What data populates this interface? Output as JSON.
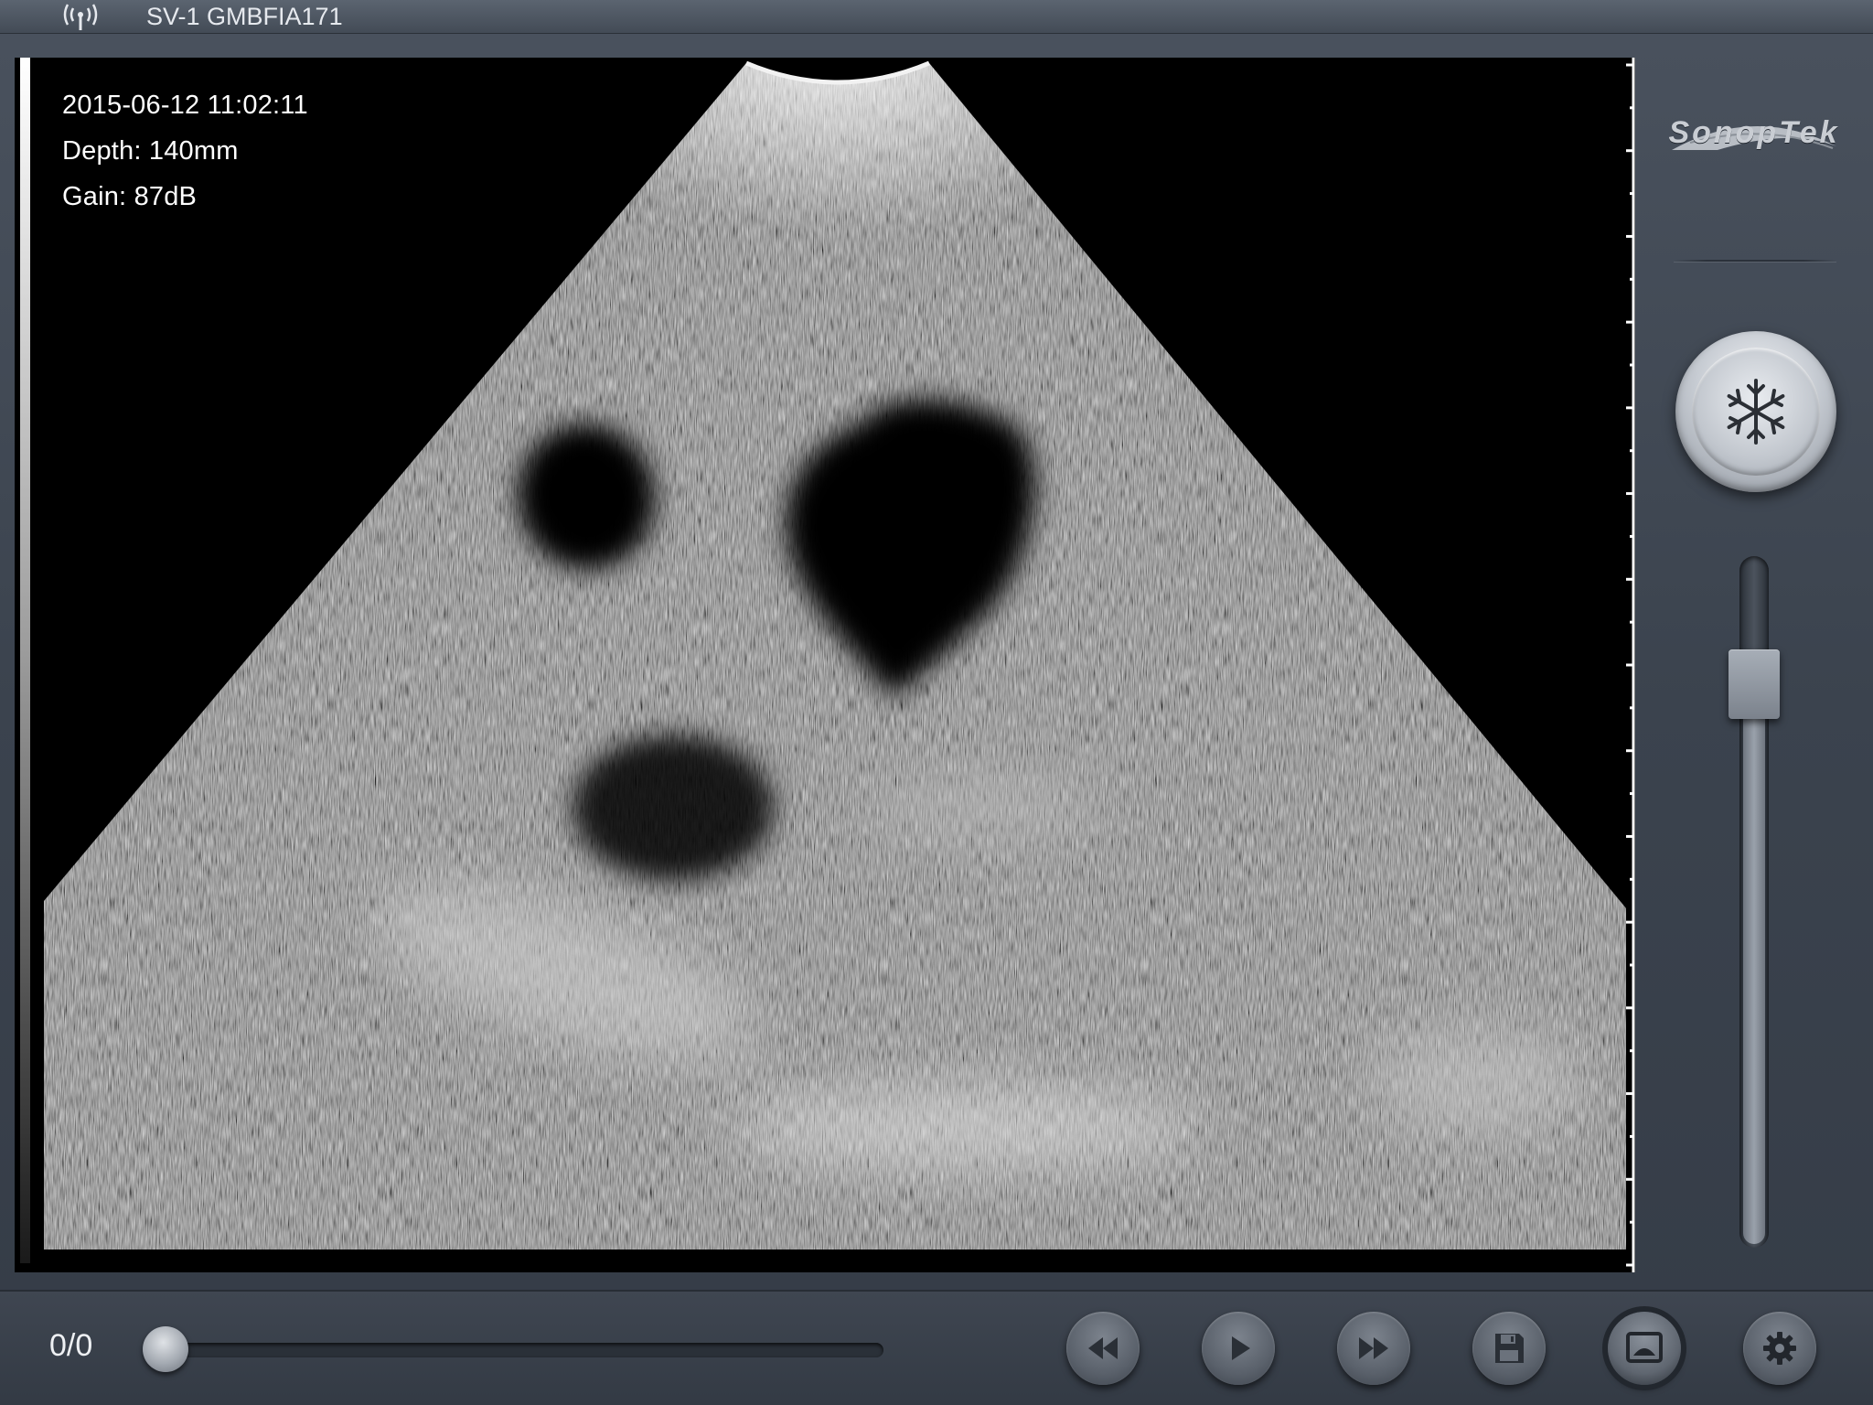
{
  "status_bar": {
    "device_name": "SV-1 GMBFIA171",
    "signal_icon": "wifi-signal-icon"
  },
  "image_overlay": {
    "datetime": "2015-06-12 11:02:11",
    "depth": "Depth: 140mm",
    "gain": "Gain: 87dB"
  },
  "side_panel": {
    "brand": "SonopTek",
    "freeze_icon": "snowflake-icon",
    "gain_slider_level": 0.85
  },
  "bottom_bar": {
    "frame_counter": "0/0",
    "cine_position": 0,
    "buttons": [
      {
        "name": "rewind-button",
        "icon": "rewind-icon"
      },
      {
        "name": "play-button",
        "icon": "play-icon"
      },
      {
        "name": "fast-forward-button",
        "icon": "fast-forward-icon"
      },
      {
        "name": "save-button",
        "icon": "floppy-disk-icon"
      },
      {
        "name": "image-view-button",
        "icon": "image-icon"
      },
      {
        "name": "settings-button",
        "icon": "gear-icon"
      }
    ]
  },
  "colors": {
    "background": "#3b434e",
    "image_background": "#000000",
    "text": "#ffffff"
  }
}
